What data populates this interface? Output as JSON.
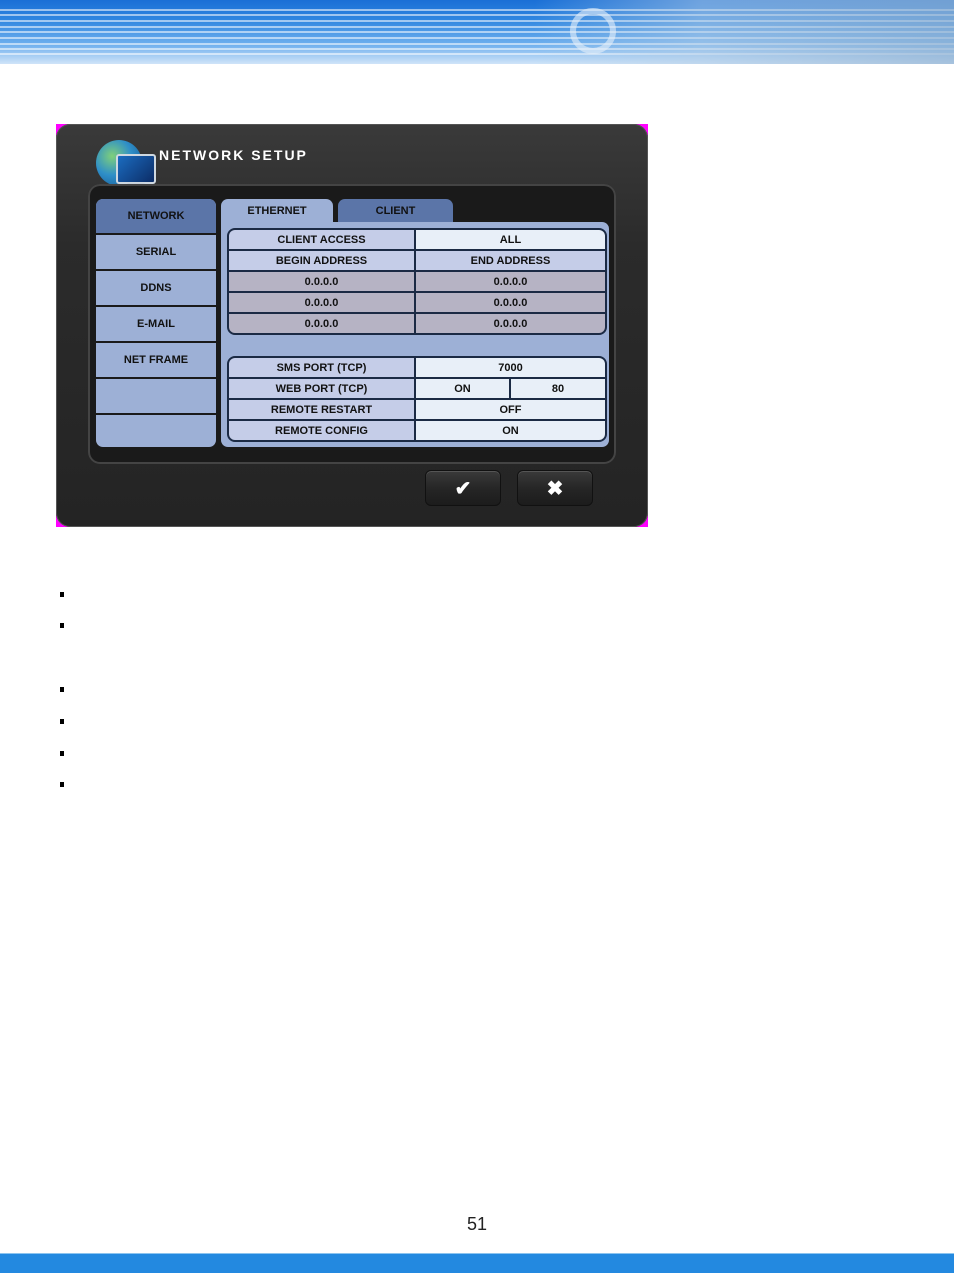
{
  "dialog": {
    "title": "NETWORK SETUP",
    "sidebar": {
      "items": [
        {
          "label": "NETWORK",
          "active": true
        },
        {
          "label": "SERIAL",
          "active": false
        },
        {
          "label": "DDNS",
          "active": false
        },
        {
          "label": "E-MAIL",
          "active": false
        },
        {
          "label": "NET FRAME",
          "active": false
        },
        {
          "label": "",
          "active": false
        },
        {
          "label": "",
          "active": false
        }
      ]
    },
    "tabs": [
      {
        "label": "ETHERNET",
        "active": false
      },
      {
        "label": "CLIENT",
        "active": true
      }
    ],
    "client_access": {
      "label": "CLIENT ACCESS",
      "value": "ALL"
    },
    "address_table": {
      "headers": [
        "BEGIN ADDRESS",
        "END ADDRESS"
      ],
      "rows": [
        [
          "0.0.0.0",
          "0.0.0.0"
        ],
        [
          "0.0.0.0",
          "0.0.0.0"
        ],
        [
          "0.0.0.0",
          "0.0.0.0"
        ]
      ]
    },
    "settings": {
      "sms_port": {
        "label": "SMS PORT (TCP)",
        "value": "7000"
      },
      "web_port": {
        "label": "WEB PORT (TCP)",
        "state": "ON",
        "port": "80"
      },
      "remote_restart": {
        "label": "REMOTE RESTART",
        "value": "OFF"
      },
      "remote_config": {
        "label": "REMOTE CONFIG",
        "value": "ON"
      }
    },
    "buttons": {
      "ok_icon": "✔",
      "cancel_icon": "✖"
    }
  },
  "page": {
    "number": "51"
  }
}
